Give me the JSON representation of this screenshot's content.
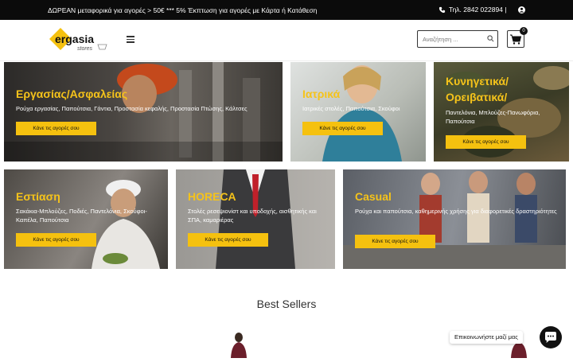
{
  "topbar": {
    "promo": "ΔΩΡΕΑΝ μεταφορικά για αγορές > 50€  ***  5% Έκπτωση για αγορές με Κάρτα ή Κατάθεση",
    "phone": "Τηλ.  2842 022894  |"
  },
  "header": {
    "logo_text": "ergasia",
    "logo_sub": "stores",
    "search_placeholder": "Αναζήτηση ...",
    "cart_count": "0"
  },
  "categories": [
    {
      "title": "Εργασίας/Ασφαλείας",
      "subtitle": "Ρούχα εργασίας, Παπούτσια, Γάντια, Προστασία κεφαλής, Προστασία Πτώσης, Κάλτσες",
      "button": "Κάνε τις αγορές σου"
    },
    {
      "title": "Ιατρικά",
      "subtitle": "Ιατρικές στολές, Παπούτσια, Σκούφοι",
      "button": "Κάνε τις αγορές σου"
    },
    {
      "title_line1": "Κυνηγετικά/",
      "title_line2": "Ορειβατικά/",
      "subtitle": "Παντελόνια, Μπλούζες-Πανωφόρια, Παπούτσια",
      "button": "Κάνε τις αγορές σου"
    },
    {
      "title": "Εστίαση",
      "subtitle": "Σακάκια-Μπλούζες, Ποδιές, Παντελόνια, Σκούφοι-Καπέλα, Παπούτσια",
      "button": "Κάνε τις αγορές σου"
    },
    {
      "title": "HORECA",
      "subtitle": "Στολές ρεσεψιονίστ και υποδοχής, αισθητικής και ΣΠΑ, καμαριέρας",
      "button": "Κάνε τις αγορές σου"
    },
    {
      "title": "Casual",
      "subtitle": "Ρούχα και παπούτσια, καθημερινής χρήσης για διαφορετικές δραστηριότητες",
      "button": "Κάνε τις αγορές σου"
    }
  ],
  "best_sellers": {
    "heading": "Best Sellers"
  },
  "chat": {
    "label": "Επικοινωνήστε μαζί μας"
  },
  "colors": {
    "accent": "#f5c10f",
    "title_yellow": "#f5c31a",
    "topbar": "#0b0b0b"
  }
}
